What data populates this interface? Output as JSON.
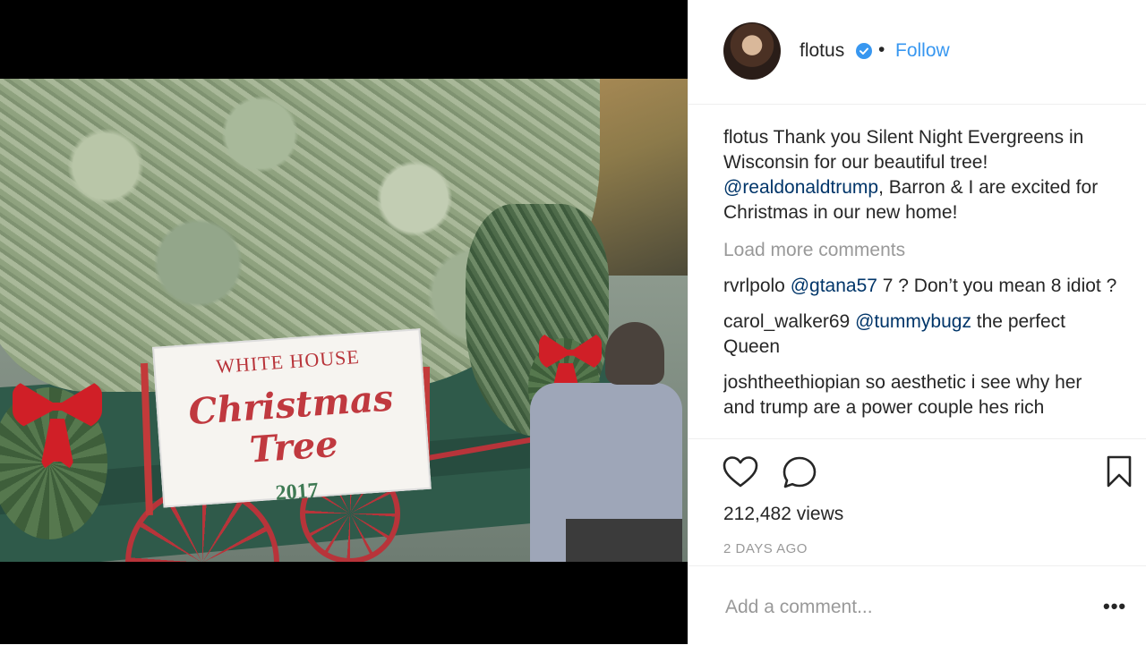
{
  "media": {
    "sign_top": "WHITE HOUSE",
    "sign_main": "Christmas Tree",
    "sign_year": "2017"
  },
  "header": {
    "username": "flotus",
    "separator": "•",
    "follow_label": "Follow"
  },
  "caption": {
    "username": "flotus",
    "text_1": " Thank you Silent Night Evergreens in Wisconsin for our beautiful tree! ",
    "mention": "@realdonaldtrump",
    "text_2": ", Barron & I are excited for Christmas in our new home!"
  },
  "load_more_label": "Load more comments",
  "comments": [
    {
      "username": "rvrlpolo",
      "mention": "@gtana57",
      "text": " 7 ? Don’t you mean 8 idiot ?"
    },
    {
      "username": "carol_walker69",
      "mention": "@tummybugz",
      "text": " the perfect Queen"
    },
    {
      "username": "joshtheethiopian",
      "mention": "",
      "text": " so aesthetic i see why her and trump are a power couple hes rich"
    }
  ],
  "stats": {
    "views": "212,482 views",
    "time_ago": "2 DAYS AGO"
  },
  "add_comment": {
    "placeholder": "Add a comment...",
    "more_label": "•••"
  },
  "colors": {
    "link": "#3897f0",
    "mention": "#003569",
    "muted": "#999999"
  }
}
